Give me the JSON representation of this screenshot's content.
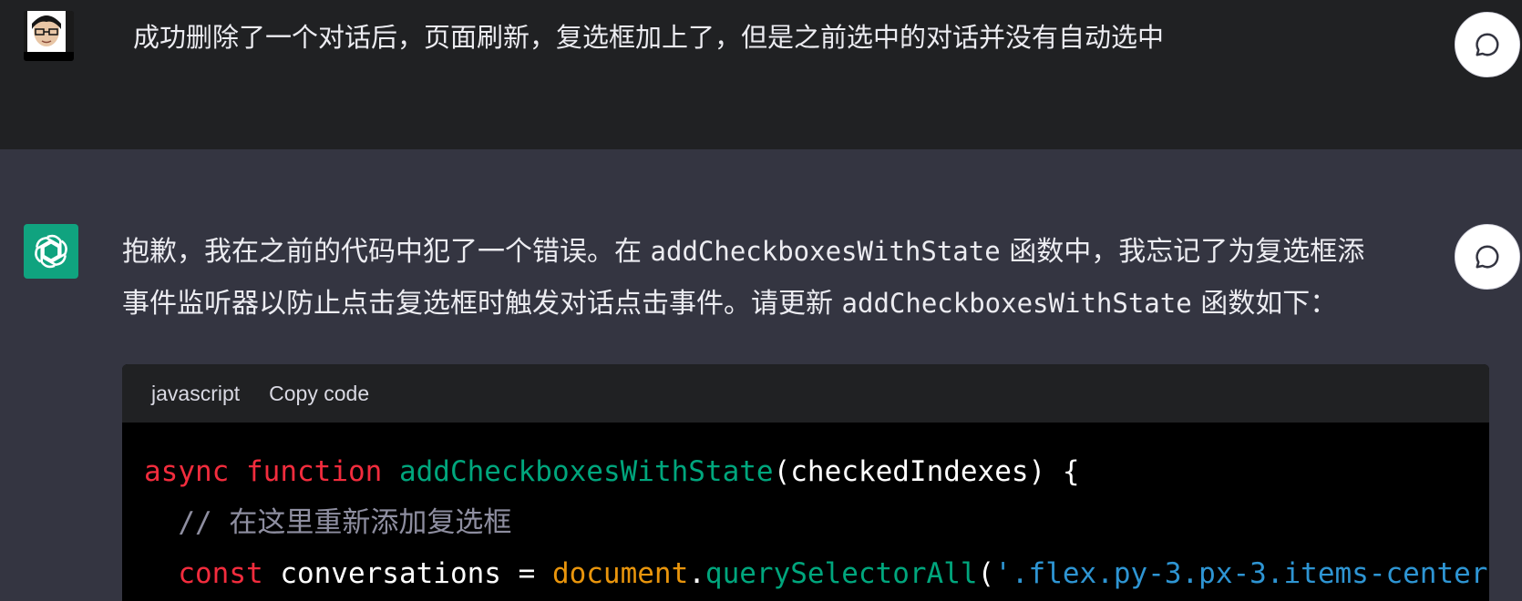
{
  "user_message": {
    "text": "成功删除了一个对话后，页面刷新，复选框加上了，但是之前选中的对话并没有自动选中"
  },
  "assistant_message": {
    "line1_prefix": "抱歉，我在之前的代码中犯了一个错误。在 ",
    "line1_code": "addCheckboxesWithState",
    "line1_suffix": " 函数中，我忘记了为复选框添",
    "line2_prefix": "事件监听器以防止点击复选框时触发对话点击事件。请更新 ",
    "line2_code": "addCheckboxesWithState",
    "line2_suffix": " 函数如下："
  },
  "code_block": {
    "language": "javascript",
    "copy_label": "Copy code",
    "line1": {
      "t1": "async",
      "t2": " ",
      "t3": "function",
      "t4": " ",
      "t5": "addCheckboxesWithState",
      "t6": "(checkedIndexes) {"
    },
    "line2": {
      "indent": "  ",
      "comment": "// 在这里重新添加复选框"
    },
    "line3": {
      "indent": "  ",
      "kw": "const",
      "t2": " conversations = ",
      "obj": "document",
      "dot": ".",
      "method": "querySelectorAll",
      "paren": "(",
      "str": "'.flex.py-3.px-3.items-center"
    }
  },
  "colors": {
    "user_row_bg": "#202123",
    "page_bg": "#343541",
    "bot_avatar": "#10a37f",
    "code_bg": "#000000",
    "code_header_bg": "#202123"
  },
  "icons": {
    "user_avatar": "user-avatar",
    "bot_avatar": "openai-logo-icon",
    "bubble": "chat-bubble-icon"
  }
}
